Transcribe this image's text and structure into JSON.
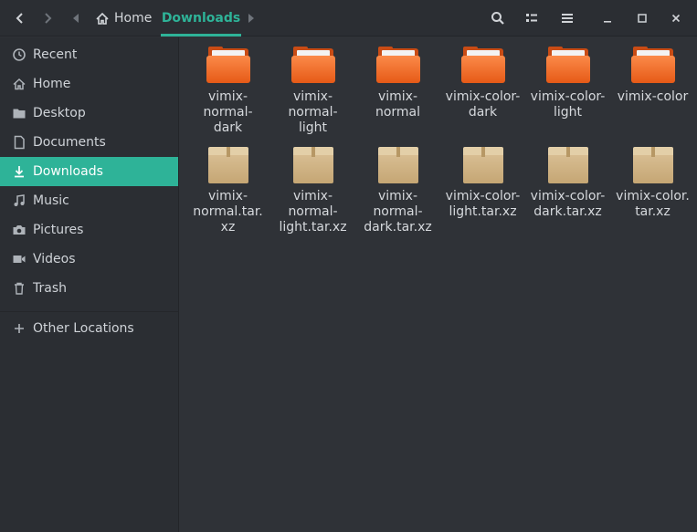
{
  "header": {
    "back_icon": "chevron-left-icon",
    "forward_icon": "chevron-right-icon",
    "breadcrumb": {
      "home_label": "Home",
      "current_label": "Downloads"
    },
    "search_icon": "search-icon",
    "view_icon": "view-toggle-icon",
    "menu_icon": "hamburger-menu-icon"
  },
  "accent_color": "#2eb398",
  "sidebar": {
    "items": [
      {
        "label": "Recent",
        "icon": "clock-icon"
      },
      {
        "label": "Home",
        "icon": "home-icon"
      },
      {
        "label": "Desktop",
        "icon": "folder-icon"
      },
      {
        "label": "Documents",
        "icon": "document-icon"
      },
      {
        "label": "Downloads",
        "icon": "download-icon",
        "active": true
      },
      {
        "label": "Music",
        "icon": "music-icon"
      },
      {
        "label": "Pictures",
        "icon": "camera-icon"
      },
      {
        "label": "Videos",
        "icon": "video-icon"
      },
      {
        "label": "Trash",
        "icon": "trash-icon"
      }
    ],
    "other_locations": "Other Locations"
  },
  "files": [
    {
      "name": "vimix-normal-dark",
      "lines": [
        "vimix-",
        "normal-",
        "dark"
      ],
      "type": "folder"
    },
    {
      "name": "vimix-normal-light",
      "lines": [
        "vimix-",
        "normal-",
        "light"
      ],
      "type": "folder"
    },
    {
      "name": "vimix-normal",
      "lines": [
        "vimix-",
        "normal"
      ],
      "type": "folder"
    },
    {
      "name": "vimix-color-dark",
      "lines": [
        "vimix-color-",
        "dark"
      ],
      "type": "folder"
    },
    {
      "name": "vimix-color-light",
      "lines": [
        "vimix-color-",
        "light"
      ],
      "type": "folder"
    },
    {
      "name": "vimix-color",
      "lines": [
        "vimix-color"
      ],
      "type": "folder"
    },
    {
      "name": "vimix-normal.tar.xz",
      "lines": [
        "vimix-",
        "normal.tar.",
        "xz"
      ],
      "type": "archive"
    },
    {
      "name": "vimix-normal-light.tar.xz",
      "lines": [
        "vimix-",
        "normal-",
        "light.tar.xz"
      ],
      "type": "archive"
    },
    {
      "name": "vimix-normal-dark.tar.xz",
      "lines": [
        "vimix-",
        "normal-",
        "dark.tar.xz"
      ],
      "type": "archive"
    },
    {
      "name": "vimix-color-light.tar.xz",
      "lines": [
        "vimix-color-",
        "light.tar.xz"
      ],
      "type": "archive"
    },
    {
      "name": "vimix-color-dark.tar.xz",
      "lines": [
        "vimix-color-",
        "dark.tar.xz"
      ],
      "type": "archive"
    },
    {
      "name": "vimix-color.tar.xz",
      "lines": [
        "vimix-color.",
        "tar.xz"
      ],
      "type": "archive"
    }
  ]
}
